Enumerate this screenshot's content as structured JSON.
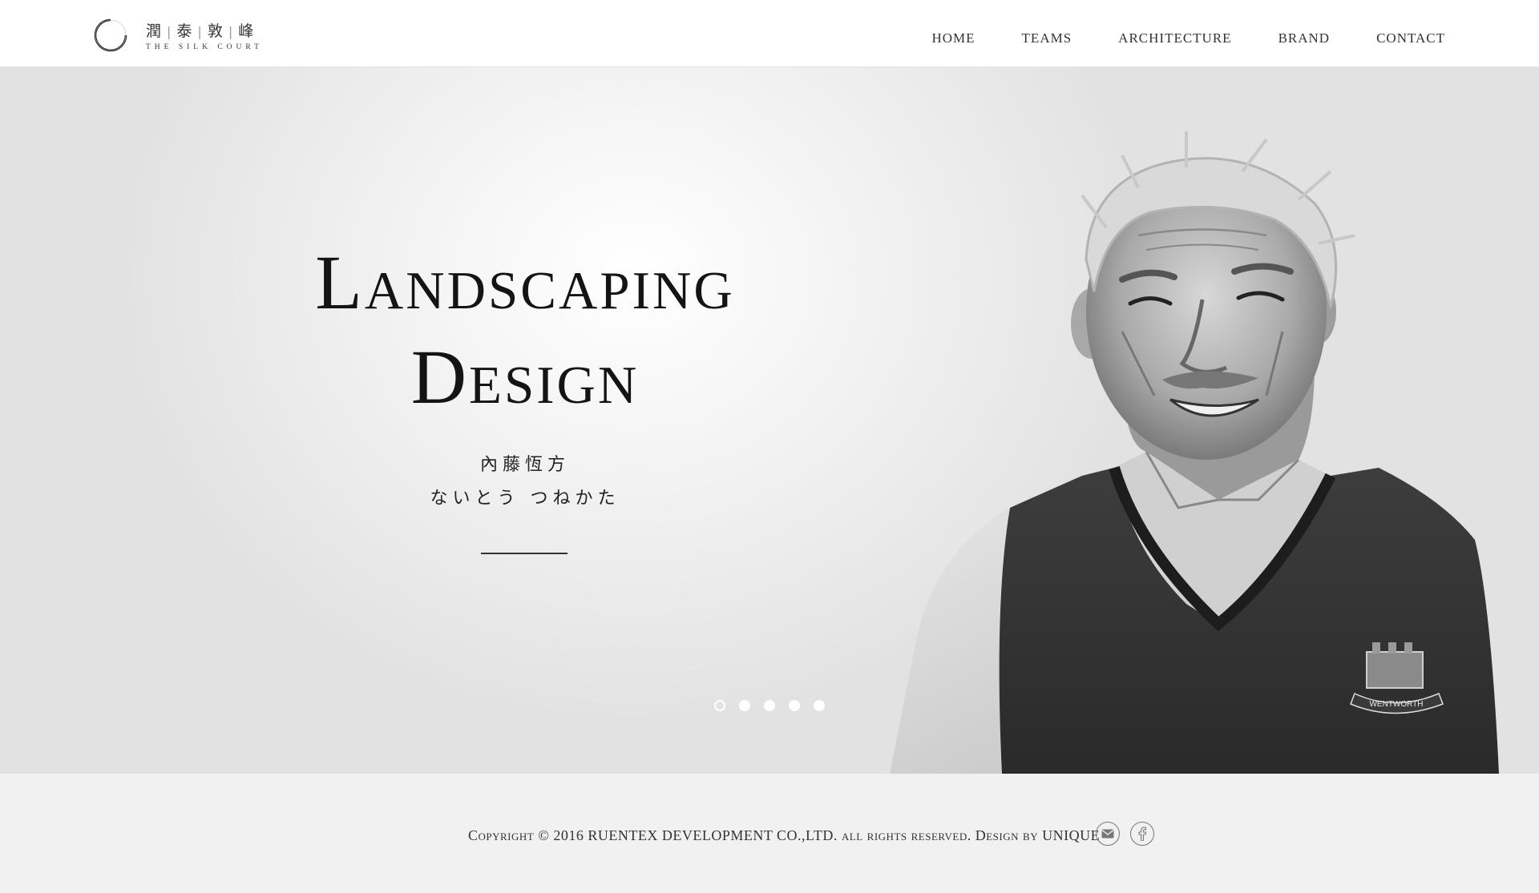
{
  "brand": {
    "name_cn": [
      "潤",
      "泰",
      "敦",
      "峰"
    ],
    "name_en": "The Silk Court"
  },
  "nav": {
    "items": [
      {
        "label": "HOME"
      },
      {
        "label": "TEAMS"
      },
      {
        "label": "ARCHITECTURE"
      },
      {
        "label": "BRAND"
      },
      {
        "label": "CONTACT"
      }
    ]
  },
  "hero": {
    "title_line1": "Landscaping",
    "title_line2": "Design",
    "name_kanji": "內藤恆方",
    "name_kana": "ないとう つねかた",
    "slides": 5,
    "active_slide": 1,
    "vest_badge": "WENTWORTH"
  },
  "footer": {
    "copyright": "Copyright © 2016 RUENTEX DEVELOPMENT CO.,LTD. all rights reserved. Design by UNIQUE",
    "social": [
      {
        "icon": "mail-icon"
      },
      {
        "icon": "facebook-icon"
      }
    ]
  },
  "colors": {
    "header_bg": "#ffffff",
    "hero_bg": "#e8e8e8",
    "footer_bg": "#f1f1f1",
    "text": "#222222"
  }
}
